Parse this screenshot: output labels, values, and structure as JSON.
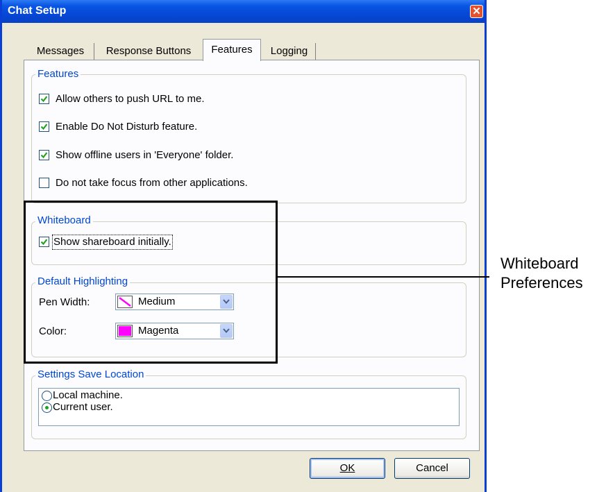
{
  "window": {
    "title": "Chat Setup",
    "close_glyph": "✕"
  },
  "tabs": [
    {
      "label": "Messages",
      "active": false
    },
    {
      "label": "Response Buttons",
      "active": false
    },
    {
      "label": "Features",
      "active": true
    },
    {
      "label": "Logging",
      "active": false
    }
  ],
  "features": {
    "legend": "Features",
    "options": [
      {
        "label": "Allow others to push URL to me.",
        "checked": true
      },
      {
        "label": "Enable Do Not Disturb feature.",
        "checked": true
      },
      {
        "label": "Show offline users in 'Everyone' folder.",
        "checked": true
      },
      {
        "label": "Do not take focus from other applications.",
        "checked": false
      }
    ]
  },
  "whiteboard": {
    "legend": "Whiteboard",
    "show_shareboard": {
      "label": "Show shareboard initially.",
      "checked": true
    }
  },
  "highlighting": {
    "legend": "Default Highlighting",
    "pen_width": {
      "label": "Pen Width:",
      "value": "Medium",
      "icon": "diagonal-pen-icon"
    },
    "color": {
      "label": "Color:",
      "value": "Magenta",
      "swatch": "#FF00FF"
    }
  },
  "save_location": {
    "legend": "Settings Save Location",
    "options": [
      {
        "label": "Local machine.",
        "selected": false
      },
      {
        "label": "Current user.",
        "selected": true
      }
    ]
  },
  "buttons": {
    "ok": "OK",
    "cancel": "Cancel"
  },
  "annotation": {
    "line1": "Whiteboard",
    "line2": "Preferences"
  },
  "colors": {
    "title_bar": "#0A56E4",
    "legend_text": "#0046D5",
    "dialog_bg": "#ECE9D8",
    "checkmark": "#21A121"
  }
}
